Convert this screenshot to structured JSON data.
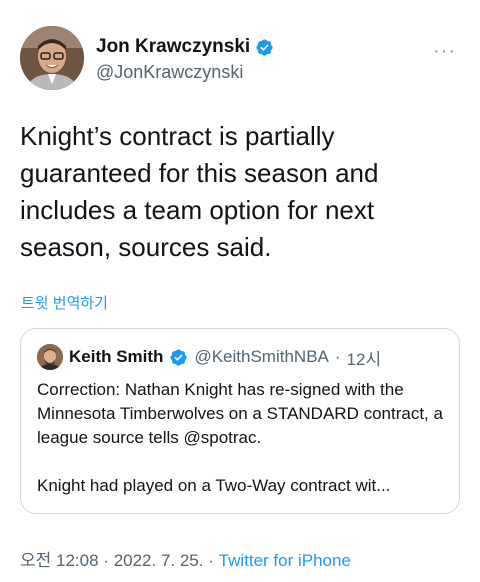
{
  "tweet": {
    "author": {
      "name": "Jon Krawczynski",
      "handle": "@JonKrawczynski",
      "verified": true
    },
    "more_label": "···",
    "text": "Knight’s contract is partially guaranteed for this season and includes a team option for next season, sources said.",
    "translate_label": "트윗 번역하기",
    "quoted": {
      "name": "Keith Smith",
      "handle": "@KeithSmithNBA",
      "separator": "·",
      "time": "12시",
      "text_para1": "Correction: Nathan Knight has re-signed with the Minnesota Timberwolves on a STANDARD contract, a league source tells @spotrac.",
      "text_para2": "Knight had played on a Two-Way contract wit..."
    },
    "meta": {
      "time": "오전 12:08",
      "sep1": "·",
      "date": "2022. 7. 25.",
      "sep2": "·",
      "source": "Twitter for iPhone"
    }
  },
  "colors": {
    "accent": "#1d9bf0",
    "text": "#0f1419",
    "secondary": "#536471",
    "border": "#cfd9de"
  },
  "icons": [
    "verified-badge-icon",
    "more-icon"
  ]
}
